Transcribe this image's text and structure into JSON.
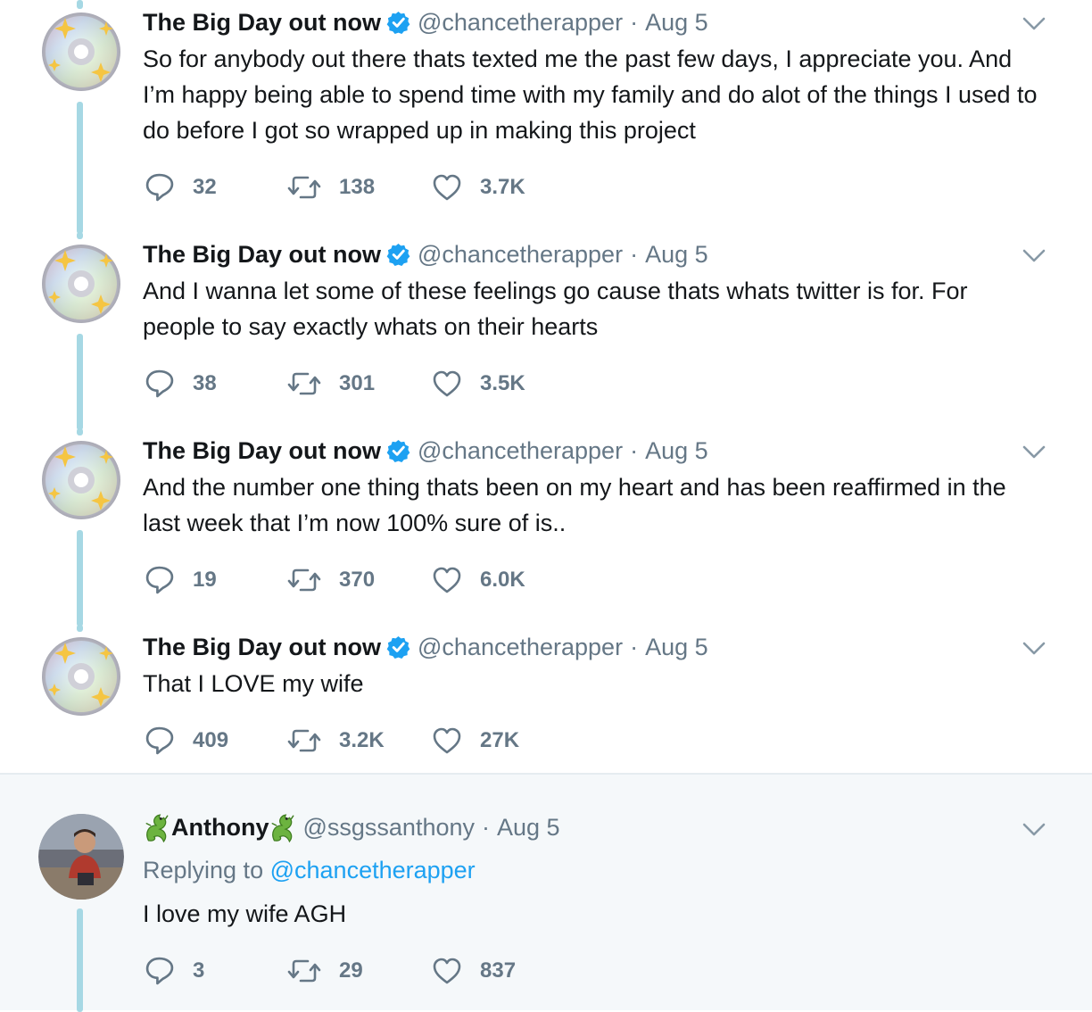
{
  "tweets": [
    {
      "name": "The Big Day out now",
      "handle": "@chancetherapper",
      "sep": "·",
      "date": "Aug 5",
      "text": "So for anybody out there thats texted me the past few days, I appreciate you. And I’m happy being able to spend time with my family and do alot of the things I used to do before I got so wrapped up in making this project",
      "replies": "32",
      "retweets": "138",
      "likes": "3.7K"
    },
    {
      "name": "The Big Day out now",
      "handle": "@chancetherapper",
      "sep": "·",
      "date": "Aug 5",
      "text": "And I wanna let some of these feelings go cause thats whats twitter is for. For people to say exactly whats on their hearts",
      "replies": "38",
      "retweets": "301",
      "likes": "3.5K"
    },
    {
      "name": "The Big Day out now",
      "handle": "@chancetherapper",
      "sep": "·",
      "date": "Aug 5",
      "text": "And the number one thing thats been on my heart and has been reaffirmed in the last week that I’m now 100% sure of is..",
      "replies": "19",
      "retweets": "370",
      "likes": "6.0K"
    },
    {
      "name": "The Big Day out now",
      "handle": "@chancetherapper",
      "sep": "·",
      "date": "Aug 5",
      "text": "That I LOVE my wife",
      "replies": "409",
      "retweets": "3.2K",
      "likes": "27K"
    }
  ],
  "reply": {
    "name": "Anthony",
    "handle": "@ssgssanthony",
    "sep": "·",
    "date": "Aug 5",
    "replying_prefix": "Replying to",
    "replying_to": "@chancetherapper",
    "text": "I love my wife AGH",
    "replies": "3",
    "retweets": "29",
    "likes": "837"
  },
  "colors": {
    "thread_line": "#a6d8e4",
    "verified": "#1da1f2",
    "secondary_text": "#657786",
    "link": "#1da1f2",
    "reply_background": "#f5f8fa"
  },
  "icons": {
    "avatar": "sparkling-cd-avatar",
    "verified": "verified-badge-icon",
    "menu": "chevron-down-icon",
    "reply": "reply-bubble-icon",
    "retweet": "retweet-icon",
    "like": "heart-icon",
    "name_emoji": "dragon-icon"
  }
}
